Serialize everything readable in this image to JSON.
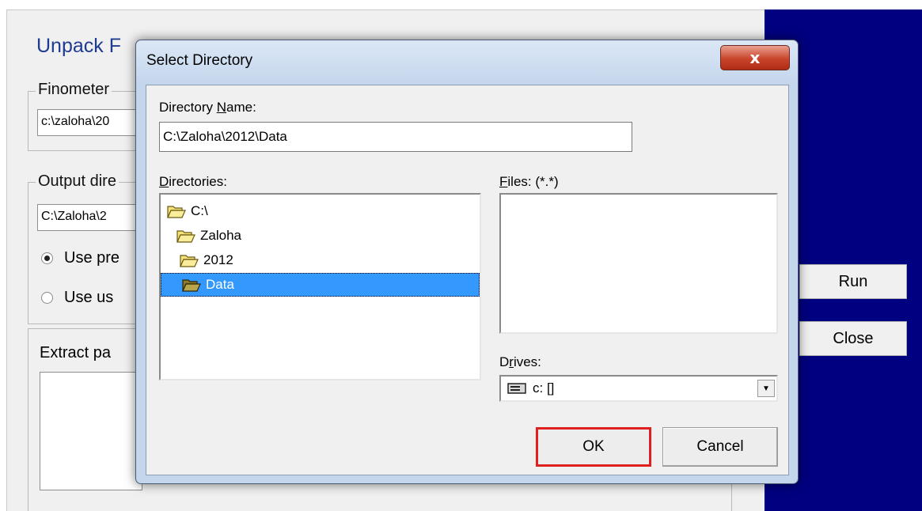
{
  "app": {
    "title": "Unpack F",
    "finometer_label": "Finometer",
    "finometer_value": "c:\\zaloha\\20",
    "output_label": "Output dire",
    "output_value": "C:\\Zaloha\\2",
    "radio_preset": "Use pre",
    "radio_user": "Use us",
    "extract_label": "Extract pa",
    "run_button": "Run",
    "close_button": "Close"
  },
  "dialog": {
    "title": "Select Directory",
    "close_glyph": "x",
    "directory_name_label_pre": "Directory ",
    "directory_name_label_ul": "N",
    "directory_name_label_post": "ame:",
    "directory_name_value": "C:\\Zaloha\\2012\\Data",
    "directories_label_ul": "D",
    "directories_label_post": "irectories:",
    "files_label_ul": "F",
    "files_label_post": "iles: (*.*)",
    "directories": [
      "C:\\",
      "Zaloha",
      "2012",
      "Data"
    ],
    "selected_directory": "Data",
    "drives_label_pre": "D",
    "drives_label_ul": "r",
    "drives_label_post": "ives:",
    "drive_value": "c: []",
    "ok_button": "OK",
    "cancel_button": "Cancel"
  },
  "colors": {
    "accent_blue": "#000080",
    "selection": "#3399ff",
    "highlight_red": "#e01f1f"
  },
  "icons": {
    "folder": "folder-icon",
    "drive": "drive-icon",
    "dropdown": "chevron-down-icon"
  }
}
